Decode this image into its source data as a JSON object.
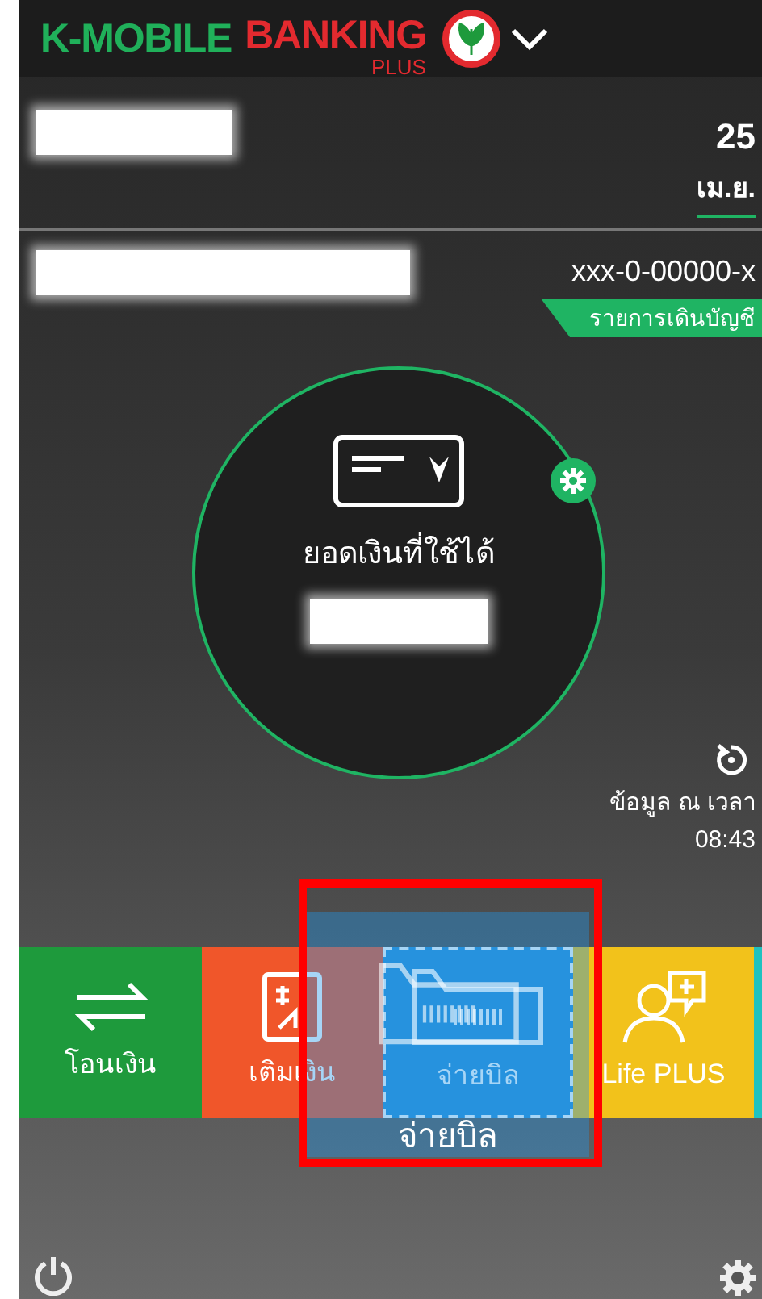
{
  "header": {
    "brand_part_1": "K-MOBILE",
    "brand_part_2": "BANKING",
    "brand_part_3": "PLUS"
  },
  "date": {
    "day": "25",
    "month": "เม.ย."
  },
  "account": {
    "number": "xxx-0-00000-x",
    "statement_tag": "รายการเดินบัญชี"
  },
  "balance": {
    "label": "ยอดเงินที่ใช้ได้"
  },
  "update": {
    "label": "ข้อมูล ณ เวลา",
    "time": "08:43"
  },
  "tiles": [
    {
      "kind": "transfer",
      "label": "โอนเงิน",
      "color": "#1e9a3c",
      "dragging": false
    },
    {
      "kind": "topup",
      "label": "เติมเงิน",
      "color": "#f0562a",
      "dragging": false
    },
    {
      "kind": "bill",
      "label": "จ่ายบิล",
      "color": "#2b8fd8",
      "dragging": true
    },
    {
      "kind": "life",
      "label": "Life PLUS",
      "color": "#f2c21b",
      "dragging": false
    },
    {
      "kind": "more",
      "color": "#1fc2c0",
      "dragging": false
    }
  ],
  "drag_overlay": {
    "kind": "bill",
    "label": "จ่ายบิล"
  }
}
